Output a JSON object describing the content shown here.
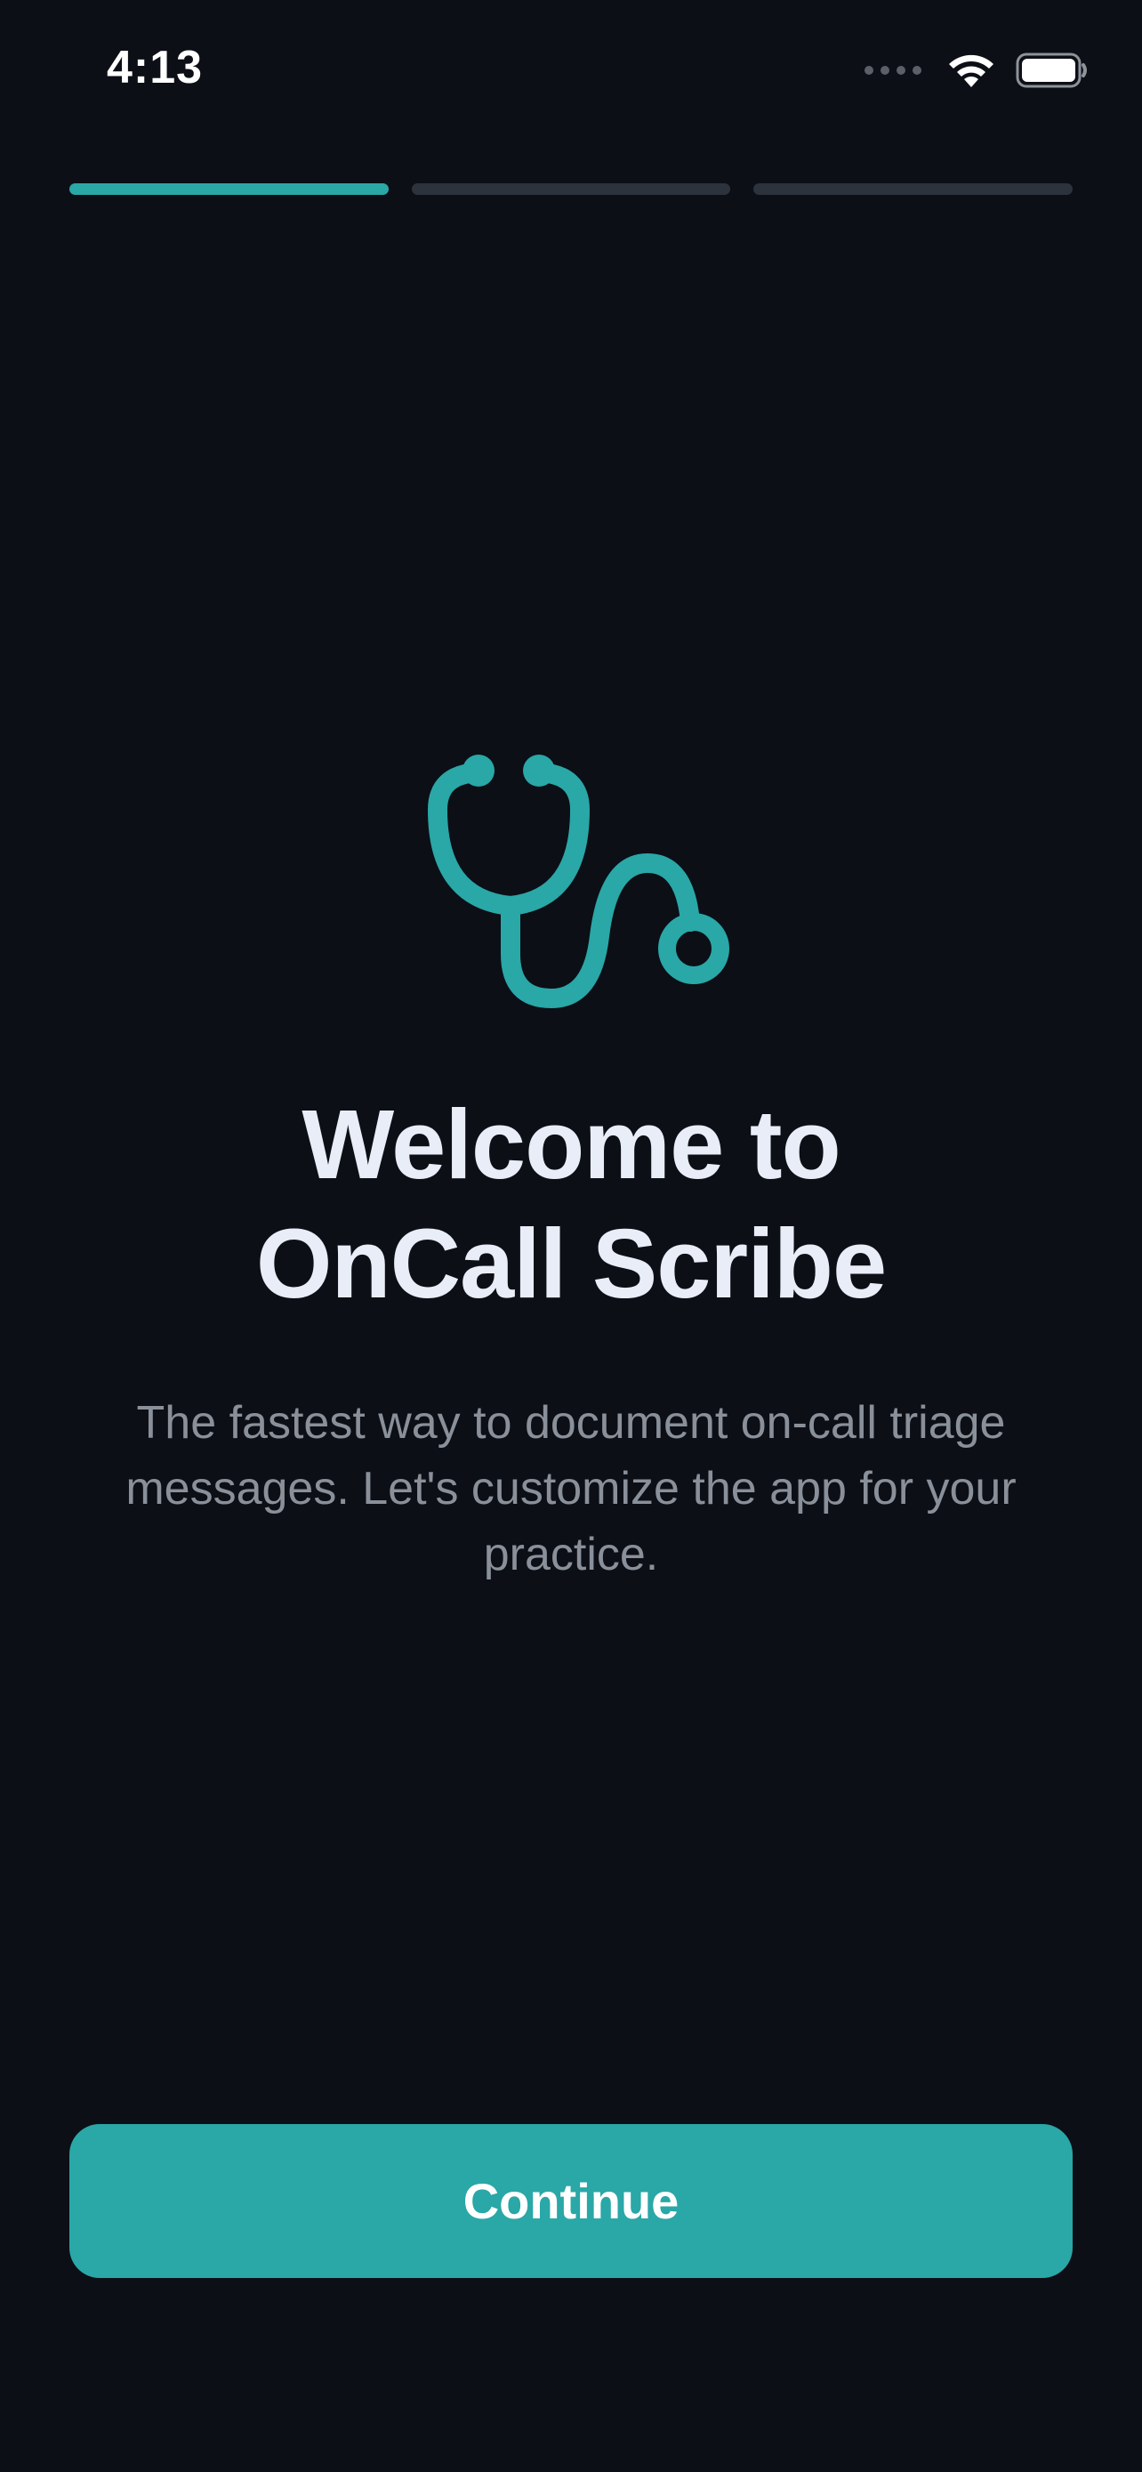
{
  "status_bar": {
    "time": "4:13",
    "icons": [
      "signal-dots-icon",
      "wifi-icon",
      "battery-icon"
    ]
  },
  "progress": {
    "total_steps": 3,
    "current_step": 1
  },
  "hero": {
    "icon": "stethoscope-icon",
    "accent_color": "#2aa7a7"
  },
  "title_line1": "Welcome to",
  "title_line2": "OnCall Scribe",
  "subtitle": "The fastest way to document on-call triage messages. Let's customize the app for your practice.",
  "continue_button": {
    "label": "Continue",
    "color": "#2aa7a7"
  },
  "colors": {
    "background": "#0c0f16",
    "progress_inactive": "#2d333c",
    "subtitle_text": "#8a9099"
  }
}
